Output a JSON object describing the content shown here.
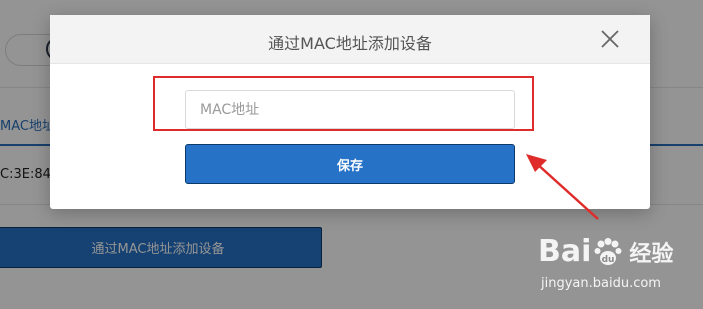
{
  "background": {
    "tab_label": "MAC地址",
    "row_value": "C:3E:84:",
    "add_button_label": "通过MAC地址添加设备"
  },
  "dialog": {
    "title": "通过MAC地址添加设备",
    "mac_input": {
      "value": "",
      "placeholder": "MAC地址"
    },
    "save_label": "保存"
  },
  "annotation": {
    "highlight_color": "#e02b2b",
    "arrow_color": "#e02b2b"
  },
  "watermark": {
    "brand": "Bai",
    "brand_suffix": "du",
    "product": "经验",
    "url": "jingyan.baidu.com"
  },
  "colors": {
    "primary": "#2572c7",
    "overlay": "rgba(0,0,0,0.42)"
  }
}
